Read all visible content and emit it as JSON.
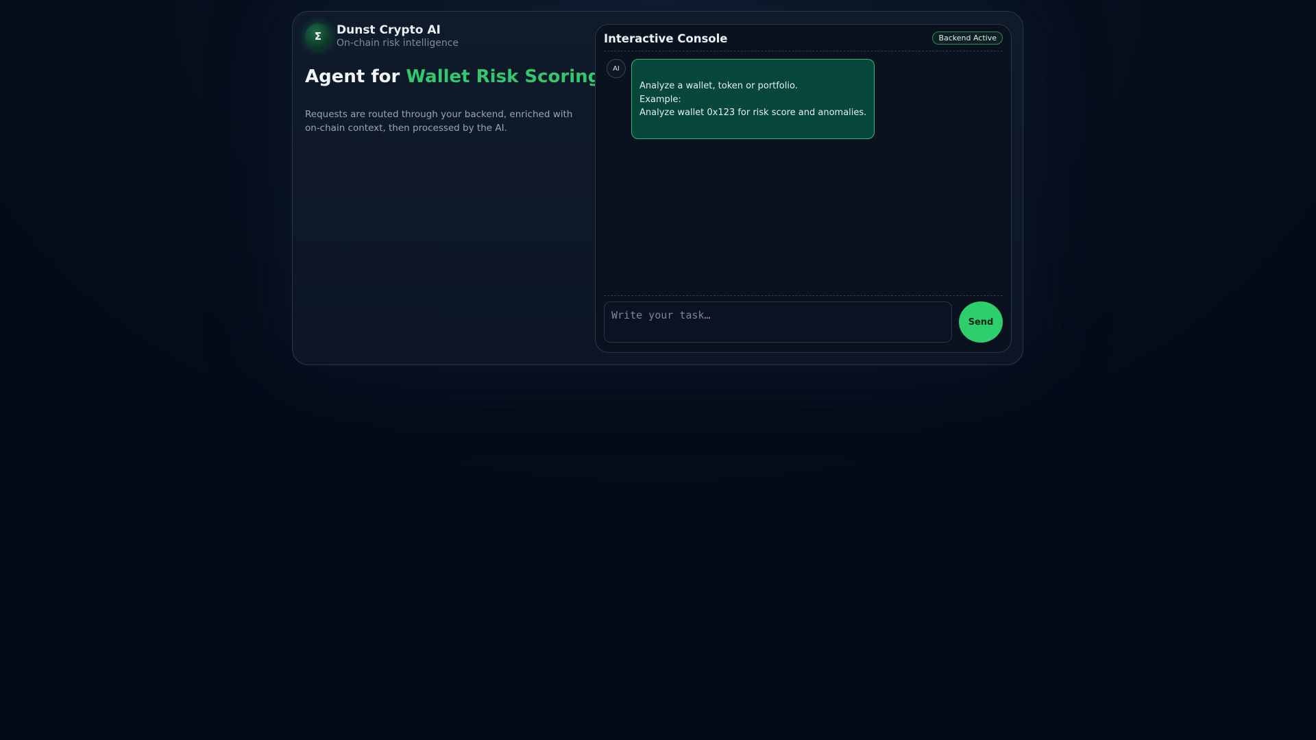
{
  "brand": {
    "logo_symbol": "Σ",
    "name": "Dunst Crypto AI",
    "subtitle": "On-chain risk intelligence"
  },
  "hero": {
    "headline_prefix": "Agent for",
    "headline_accent": "Wallet Risk Scoring",
    "description": "Requests are routed through your backend, enriched with on-chain context, then processed by the AI."
  },
  "console": {
    "title": "Interactive Console",
    "status_badge": "Backend Active",
    "messages": [
      {
        "sender_label": "AI",
        "lines": [
          "Analyze a wallet, token or portfolio.",
          "Example:",
          "Analyze wallet 0x123 for risk score and anomalies."
        ]
      }
    ],
    "input": {
      "value": "",
      "placeholder": "Write your task…"
    },
    "send_label": "Send"
  },
  "colors": {
    "accent": "#34c86e",
    "send_button": "#2dce6c",
    "bubble_bg": "#07463a",
    "bubble_border": "#2fb96a",
    "page_bg": "#040a17"
  }
}
